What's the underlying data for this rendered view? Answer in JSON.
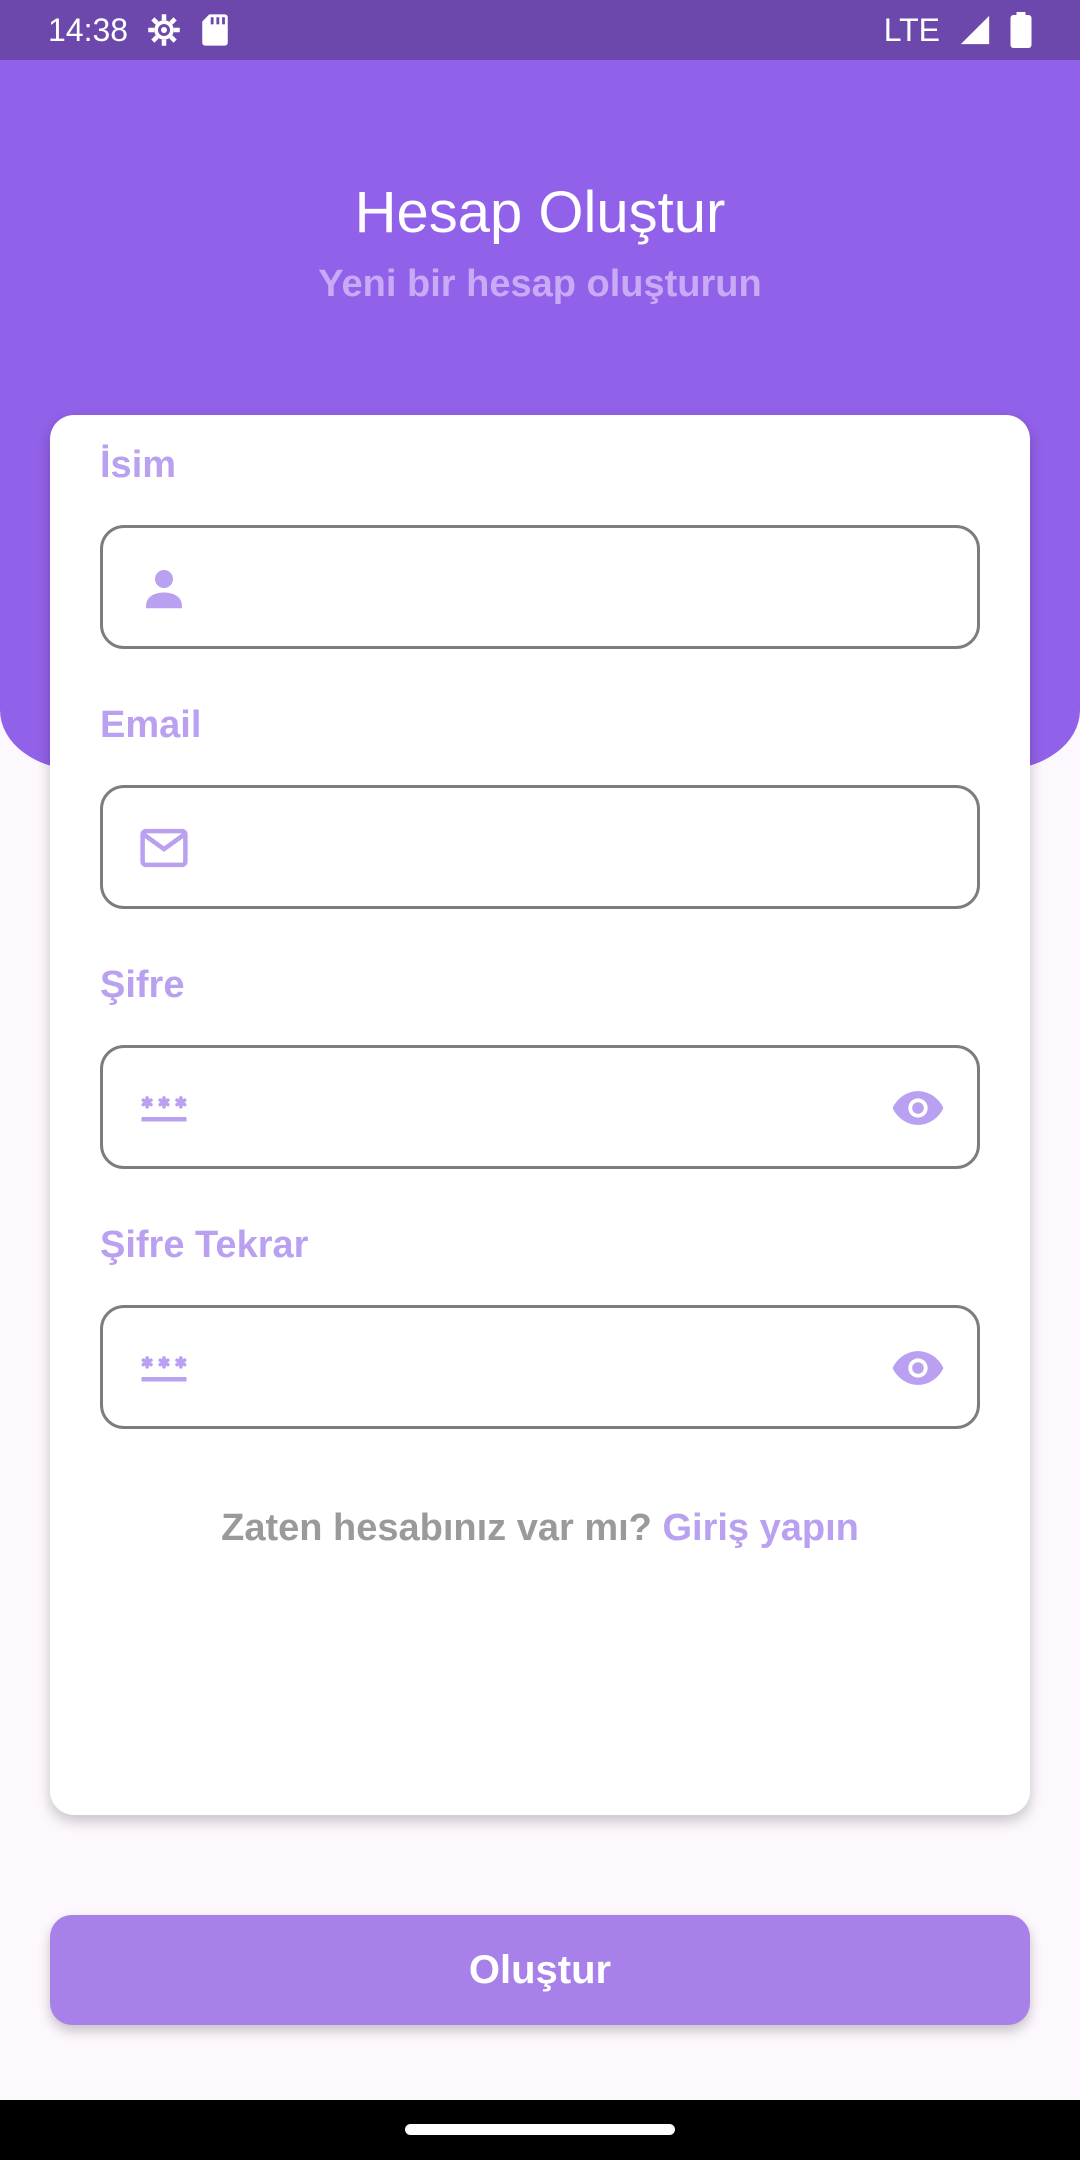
{
  "status_bar": {
    "time": "14:38",
    "network": "LTE",
    "icons": [
      "settings-icon",
      "sd-card-icon",
      "signal-icon",
      "battery-icon"
    ]
  },
  "header": {
    "title": "Hesap Oluştur",
    "subtitle": "Yeni bir hesap oluşturun"
  },
  "form": {
    "fields": [
      {
        "label": "İsim",
        "value": "",
        "icon": "person-icon"
      },
      {
        "label": "Email",
        "value": "",
        "icon": "mail-icon"
      },
      {
        "label": "Şifre",
        "value": "",
        "icon": "password-icon",
        "trailing_icon": "eye-icon"
      },
      {
        "label": "Şifre Tekrar",
        "value": "",
        "icon": "password-icon",
        "trailing_icon": "eye-icon"
      }
    ],
    "login_prompt": "Zaten hesabınız var mı?",
    "login_link": "Giriş yapın"
  },
  "submit_label": "Oluştur",
  "colors": {
    "status_bar": "#6c48ad",
    "header": "#9261e9",
    "accent_light": "#b9a0f0",
    "button": "#a780ea",
    "border": "#7d7d7d",
    "muted_text": "#9a9a9a"
  }
}
